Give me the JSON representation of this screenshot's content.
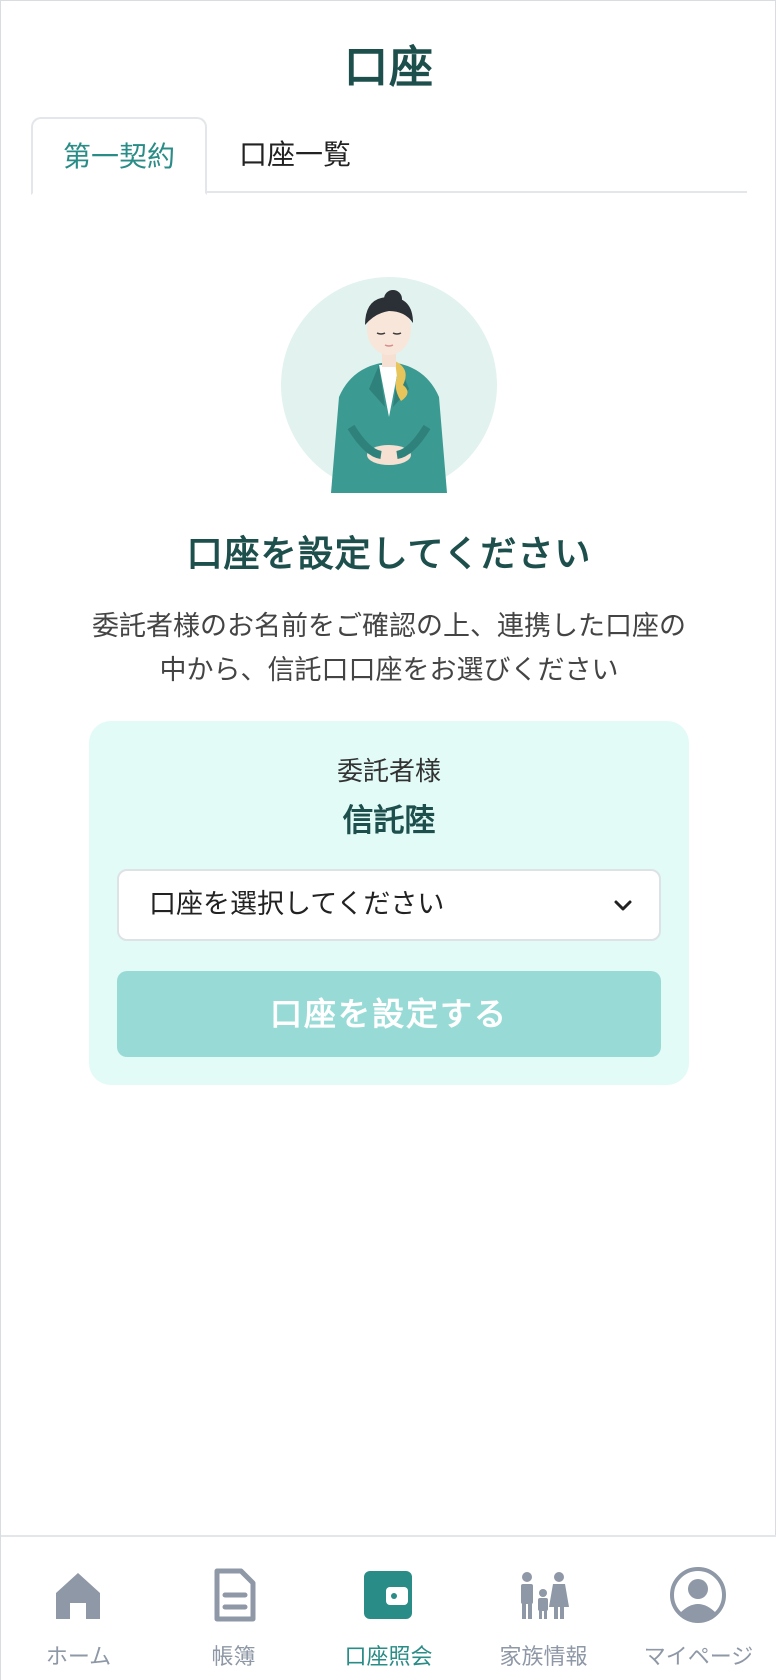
{
  "header": {
    "title": "口座"
  },
  "tabs": [
    {
      "label": "第一契約",
      "active": true
    },
    {
      "label": "口座一覧",
      "active": false
    }
  ],
  "main": {
    "heading": "口座を設定してください",
    "description": "委託者様のお名前をご確認の上、連携した口座の中から、信託口口座をお選びください",
    "card": {
      "label": "委託者様",
      "name": "信託陸",
      "select_placeholder": "口座を選択してください",
      "submit_label": "口座を設定する"
    }
  },
  "bottom_nav": [
    {
      "label": "ホーム",
      "icon": "home-icon",
      "active": false
    },
    {
      "label": "帳簿",
      "icon": "document-icon",
      "active": false
    },
    {
      "label": "口座照会",
      "icon": "wallet-icon",
      "active": true
    },
    {
      "label": "家族情報",
      "icon": "family-icon",
      "active": false
    },
    {
      "label": "マイページ",
      "icon": "user-icon",
      "active": false
    }
  ],
  "colors": {
    "primary": "#2a8c87",
    "heading": "#1d4f4c",
    "card_bg": "#e2fbf7",
    "button_disabled": "#98dbd6",
    "nav_inactive": "#8e98a6"
  }
}
